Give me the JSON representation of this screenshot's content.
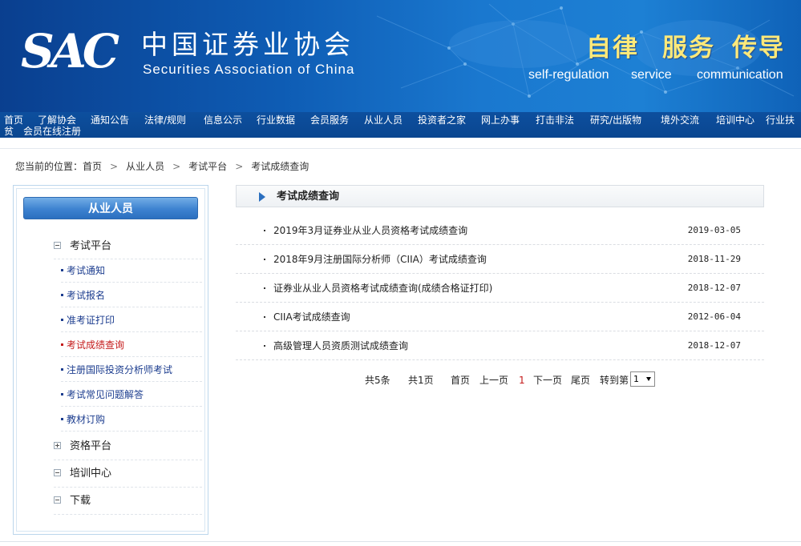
{
  "header": {
    "logo_text": "SAC",
    "org_name_cn": "中国证券业协会",
    "org_name_en": "Securities Association of China",
    "slogans_cn": [
      "自律",
      "服务",
      "传导"
    ],
    "slogans_en": [
      "self-regulation",
      "service",
      "communication"
    ]
  },
  "nav": {
    "items": [
      "首页",
      "了解协会",
      "通知公告",
      "法律/规则",
      "信息公示",
      "行业数据",
      "会员服务",
      "从业人员",
      "投资者之家",
      "网上办事",
      "打击非法",
      "研究/出版物",
      "境外交流",
      "培训中心",
      "行业扶",
      "贫",
      "会员在线注册"
    ]
  },
  "breadcrumb": {
    "prefix": "您当前的位置：",
    "items": [
      "首页",
      "从业人员",
      "考试平台",
      "考试成绩查询"
    ],
    "separator": ">"
  },
  "sidebar": {
    "title": "从业人员",
    "groups": [
      {
        "label": "考试平台",
        "expanded": true
      },
      {
        "label": "资格平台",
        "expanded": false
      },
      {
        "label": "培训中心",
        "expanded": true
      },
      {
        "label": "下载",
        "expanded": true
      }
    ],
    "sub_items": [
      "考试通知",
      "考试报名",
      "准考证打印",
      "考试成绩查询",
      "注册国际投资分析师考试",
      "考试常见问题解答",
      "教材订购"
    ],
    "active_sub": "考试成绩查询"
  },
  "content": {
    "title": "考试成绩查询",
    "rows": [
      {
        "title": "2019年3月证券业从业人员资格考试成绩查询",
        "date": "2019-03-05"
      },
      {
        "title": "2018年9月注册国际分析师（CIIA）考试成绩查询",
        "date": "2018-11-29"
      },
      {
        "title": "证券业从业人员资格考试成绩查询(成绩合格证打印)",
        "date": "2018-12-07"
      },
      {
        "title": "CIIA考试成绩查询",
        "date": "2012-06-04"
      },
      {
        "title": "高级管理人员资质测试成绩查询",
        "date": "2018-12-07"
      }
    ]
  },
  "pagination": {
    "total_items": "共5条",
    "total_pages": "共1页",
    "first": "首页",
    "prev": "上一页",
    "current": "1",
    "next": "下一页",
    "last": "尾页",
    "goto_label": "转到第",
    "selected_page": "1"
  },
  "colors": {
    "banner_blue": "#0e5cb4",
    "nav_blue": "#0a4690",
    "slogan_yellow": "#fde97a",
    "active_red": "#c41a1a",
    "link_blue": "#1c3d8f"
  }
}
